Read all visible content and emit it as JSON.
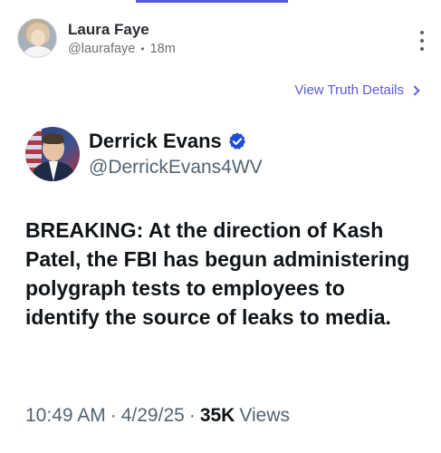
{
  "post": {
    "author_name": "Laura Faye",
    "author_handle": "@laurafaye",
    "separator": "•",
    "timestamp": "18m",
    "view_details_label": "View Truth Details"
  },
  "embedded": {
    "name": "Derrick Evans",
    "handle": "@DerrickEvans4WV",
    "text": "BREAKING: At the direction of Kash Patel, the FBI has begun administering polygraph tests to employees to identify the source of leaks to media.",
    "time": "10:49 AM",
    "dot": "·",
    "date": "4/29/25",
    "views_count": "35K",
    "views_label": "Views"
  },
  "colors": {
    "accent": "#5b5bd6",
    "verified": "#1d4ed8",
    "secondary_text": "#536471"
  },
  "icons": {
    "more": "more-vertical-icon",
    "chevron": "chevron-right-icon",
    "verified": "verified-badge-icon"
  }
}
